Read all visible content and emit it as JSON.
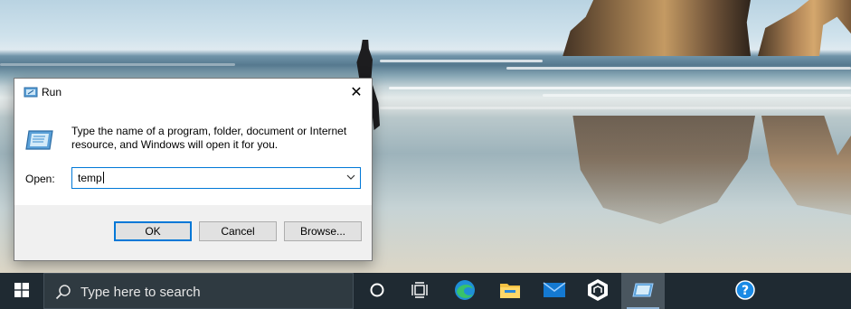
{
  "dialog": {
    "title": "Run",
    "close_glyph": "✕",
    "description": "Type the name of a program, folder, document or Internet resource, and Windows will open it for you.",
    "open_label": "Open:",
    "open_value": "temp",
    "buttons": {
      "ok": "OK",
      "cancel": "Cancel",
      "browse": "Browse..."
    }
  },
  "taskbar": {
    "search_placeholder": "Type here to search",
    "items": [
      "cortana-icon",
      "task-view-icon",
      "edge-icon",
      "file-explorer-icon",
      "mail-icon",
      "app-icon",
      "run-icon"
    ],
    "tray": [
      "help-icon"
    ]
  },
  "colors": {
    "accent": "#0078d7",
    "taskbar": "#1f2a32",
    "dialog_footer": "#f0f0f0"
  }
}
